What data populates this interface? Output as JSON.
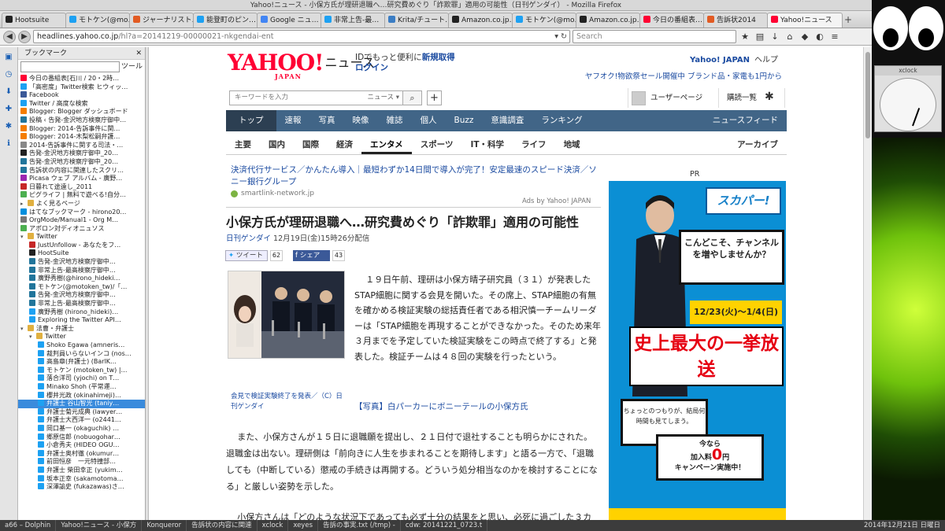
{
  "window": {
    "title": "Yahoo!ニュース - 小保方氏が理研退職へ…研究費めぐり「詐欺罪」適用の可能性（日刊ゲンダイ） - Mozilla Firefox"
  },
  "tabs": [
    {
      "label": "Hootsuite",
      "color": "#222"
    },
    {
      "label": "モトケン(@mo…",
      "color": "#1da1f2"
    },
    {
      "label": "ジャーナリスト…",
      "color": "#e25b23"
    },
    {
      "label": "能登町のピン…",
      "color": "#1da1f2"
    },
    {
      "label": "Google ニュ…",
      "color": "#4285f4"
    },
    {
      "label": "非常上告-最…",
      "color": "#1da1f2"
    },
    {
      "label": "Krita/チュート…",
      "color": "#3b7dc4"
    },
    {
      "label": "Amazon.co.jp…",
      "color": "#222"
    },
    {
      "label": "モトケン(@mo…",
      "color": "#1da1f2"
    },
    {
      "label": "Amazon.co.jp…",
      "color": "#222"
    },
    {
      "label": "今日の番組表…",
      "color": "#ff0033"
    },
    {
      "label": "告訴状2014",
      "color": "#e25b23"
    },
    {
      "label": "Yahoo!ニュース",
      "color": "#ff0033"
    }
  ],
  "nav": {
    "url_prefix": "headlines.yahoo.co.jp",
    "url_rest": "/hl?a=20141219-00000021-nkgendai-ent",
    "search_placeholder": "Search"
  },
  "sidebar": {
    "title": "ブックマーク",
    "tools": "ツール",
    "items": [
      {
        "label": "今日の番組表[石川 / 20・2時…",
        "color": "#ff0033",
        "indent": 0
      },
      {
        "label": "「高密度」Twitter検索 ヒウィッ…",
        "color": "#1da1f2",
        "indent": 0
      },
      {
        "label": "Facebook",
        "color": "#3b5998",
        "indent": 0
      },
      {
        "label": "Twitter / 高度な検索",
        "color": "#1da1f2",
        "indent": 0
      },
      {
        "label": "Blogger: Blogger ダッシュボード",
        "color": "#f57d00",
        "indent": 0
      },
      {
        "label": "投稿 ‹ 告発-金沢地方検察庁御中…",
        "color": "#21759b",
        "indent": 0
      },
      {
        "label": "Blogger: 2014-告訴事件に関…",
        "color": "#f57d00",
        "indent": 0
      },
      {
        "label": "Blogger: 2014-木梨松嗣弁護…",
        "color": "#f57d00",
        "indent": 0
      },
      {
        "label": "2014-告訴事件に関する司法・…",
        "color": "#888",
        "indent": 0
      },
      {
        "label": "告発-金沢地方検察庁御中_20…",
        "color": "#222",
        "indent": 0
      },
      {
        "label": "告発-金沢地方検察庁御中_20…",
        "color": "#21759b",
        "indent": 0
      },
      {
        "label": "告訴状の内容に関連したスクリ…",
        "color": "#21759b",
        "indent": 0
      },
      {
        "label": "Picasa ウェブ アルバム - 廣野…",
        "color": "#9c27b0",
        "indent": 0
      },
      {
        "label": "日暮れて途遠し_2011",
        "color": "#c62828",
        "indent": 0
      },
      {
        "label": "ピグライフ | 無料で遊べる!自分…",
        "color": "#4caf50",
        "indent": 0
      },
      {
        "label": "よく見るページ",
        "color": "#e0b040",
        "indent": 0,
        "tri": "▸"
      },
      {
        "label": "はてなブックマーク - hirono20…",
        "color": "#008fde",
        "indent": 0
      },
      {
        "label": "OrgMode/Manual1 - Org M…",
        "color": "#777",
        "indent": 0
      },
      {
        "label": "アポロン対ディオニュソス",
        "color": "#4caf50",
        "indent": 0
      },
      {
        "label": "Twitter",
        "color": "#e0b040",
        "indent": 0,
        "tri": "▾"
      },
      {
        "label": "JustUnfollow - あなたをフ…",
        "color": "#c62828",
        "indent": 1
      },
      {
        "label": "HootSuite",
        "color": "#222",
        "indent": 1
      },
      {
        "label": "告発-金沢地方検察庁御中…",
        "color": "#21759b",
        "indent": 1
      },
      {
        "label": "非常上告-最高検察庁御中…",
        "color": "#21759b",
        "indent": 1
      },
      {
        "label": "廣野秀樹(@hirono_hideki…",
        "color": "#21759b",
        "indent": 1
      },
      {
        "label": "モトケン(@motoken_tw)/「…",
        "color": "#21759b",
        "indent": 1
      },
      {
        "label": "告発-金沢地方検察庁御中…",
        "color": "#21759b",
        "indent": 1
      },
      {
        "label": "非常上告-最高検察庁御中…",
        "color": "#21759b",
        "indent": 1
      },
      {
        "label": "廣野秀樹 (hirono_hideki)…",
        "color": "#1da1f2",
        "indent": 1
      },
      {
        "label": "Exploring the Twitter API…",
        "color": "#1da1f2",
        "indent": 1
      },
      {
        "label": "法曹・弁護士",
        "color": "#e0b040",
        "indent": 0,
        "tri": "▾"
      },
      {
        "label": "Twitter",
        "color": "#e0b040",
        "indent": 1,
        "tri": "▾"
      },
      {
        "label": "Shoko Egawa (amneris…",
        "color": "#1da1f2",
        "indent": 2
      },
      {
        "label": "裁判員いらないインコ (nos…",
        "color": "#1da1f2",
        "indent": 2
      },
      {
        "label": "高島章(弁護士) (BarlK…",
        "color": "#1da1f2",
        "indent": 2
      },
      {
        "label": "モトケン (motoken_tw) |…",
        "color": "#1da1f2",
        "indent": 2
      },
      {
        "label": "落合洋司 (yjochi) on T…",
        "color": "#1da1f2",
        "indent": 2
      },
      {
        "label": "Minako Shoh (平常運…",
        "color": "#1da1f2",
        "indent": 2
      },
      {
        "label": "櫻井光政 (okinahimeji)…",
        "color": "#1da1f2",
        "indent": 2
      },
      {
        "label": "弁護士 谷山智光 (taniy…",
        "color": "#1da1f2",
        "indent": 2,
        "selected": true
      },
      {
        "label": "弁護士菊元成典 (lawyer…",
        "color": "#1da1f2",
        "indent": 2
      },
      {
        "label": "弁護士大西洋一 (o2441…",
        "color": "#1da1f2",
        "indent": 2
      },
      {
        "label": "岡口基一 (okaguchik) …",
        "color": "#1da1f2",
        "indent": 2
      },
      {
        "label": "郷原信郎 (nobuogohar…",
        "color": "#1da1f2",
        "indent": 2
      },
      {
        "label": "小倉秀夫 (HIDEO OGU…",
        "color": "#1da1f2",
        "indent": 2
      },
      {
        "label": "弁護士奥村徹 (okumur…",
        "color": "#1da1f2",
        "indent": 2
      },
      {
        "label": "前田恒彦　一元特捜部…",
        "color": "#1da1f2",
        "indent": 2
      },
      {
        "label": "弁護士 柴田幸正 (yukim…",
        "color": "#1da1f2",
        "indent": 2
      },
      {
        "label": "坂本正幸 (sakamotoma…",
        "color": "#1da1f2",
        "indent": 2
      },
      {
        "label": "深澤諭史 (fukazawas)さ…",
        "color": "#1da1f2",
        "indent": 2
      }
    ]
  },
  "page": {
    "logo": "YAHOO!",
    "logo_sub": "JAPAN",
    "logo_news": "ニュース",
    "id_promo": "IDでもっと便利に",
    "id_signup": "新規取得",
    "id_login": "ログイン",
    "yahoo_japan": "Yahoo! JAPAN",
    "help": "ヘルプ",
    "promo": "ヤフオク!物欲祭セール開催中 ブランド品・家電も1円から",
    "kw_placeholder": "キーワードを入力",
    "kw_cat": "ニュース ▾",
    "user_page": "ユーザーページ",
    "subscriptions": "購読一覧",
    "nav1": [
      "トップ",
      "速報",
      "写真",
      "映像",
      "雑誌",
      "個人",
      "Buzz",
      "意識調査",
      "ランキング"
    ],
    "nav1_right": "ニュースフィード",
    "nav2": [
      "主要",
      "国内",
      "国際",
      "経済",
      "エンタメ",
      "スポーツ",
      "IT・科学",
      "ライフ",
      "地域"
    ],
    "nav2_right": "アーカイブ",
    "ad_text": "決済代行サービス／かんたん導入｜最短わずか14日間で導入が完了！安定最速のスピード決済／ソニー銀行グループ",
    "ad_src": "smartlink-network.jp",
    "ads_by": "Ads by Yahoo! JAPAN",
    "headline": "小保方氏が理研退職へ…研究費めぐり「詐欺罪」適用の可能性",
    "source": "日刊ゲンダイ",
    "datetime": "12月19日(金)15時26分配信",
    "tweet": "ツイート",
    "tweet_count": "62",
    "share": "シェア",
    "share_count": "43",
    "caption": "会見で検証実験終了を発表／（C）日刊ゲンダイ",
    "para1": "１９日午前、理研は小保方晴子研究員（３１）が発表したSTAP細胞に関する会見を開いた。その席上、STAP細胞の有無を確かめる検証実験の総括責任者である相沢慎一チームリーダーは「STAP細胞を再現することができなかった。そのため来年３月までを予定していた検証実験をこの時点で終了する」と発表した。検証チームは４８回の実験を行ったという。",
    "photo_link": "【写真】白パーカーにボニーテールの小保方氏",
    "para2": "また、小保方さんが１５日に退職願を提出し、２１日付で退社することも明らかにされた。退職金は出ない。理研側は「前向きに人生を歩まれることを期待します」と語る一方で、「退職しても（中断している）懲戒の手続きは再開する。どういう処分相当なのかを検討することになる」と厳しい姿勢を示した。",
    "para3": "小保方さんは「どのような状況下であっても必ず十分の結果をと思い、必死に過ごした３カ",
    "pr_label": "PR",
    "pr_brand": "スカパー!",
    "pr_tv_text": "こんどこそ、チャンネルを増やしませんか？",
    "pr_date": "12/23(火)〜1/4(日)",
    "pr_big": "史上最大の一挙放送",
    "pr_small": "ちょっとのつもりが、結局何時間も見てしまう。",
    "pr_cmp1": "今なら",
    "pr_cmp2": "加入料",
    "pr_cmp_zero": "0",
    "pr_cmp_yen": "円",
    "pr_cmp3": "キャンペーン実施中！"
  },
  "taskbar": {
    "items": [
      "a66 – Dolphin",
      "Yahoo!ニュース - 小保方",
      "Konqueror",
      "告訴状の内容に関連",
      "xclock",
      "xeyes",
      "告訴の事実.txt (/tmp) - ",
      "cdw: 20141221_0723.t"
    ],
    "clock": "2014年12月21日 日曜日"
  },
  "desktop": {
    "xclock_title": "xclock"
  }
}
